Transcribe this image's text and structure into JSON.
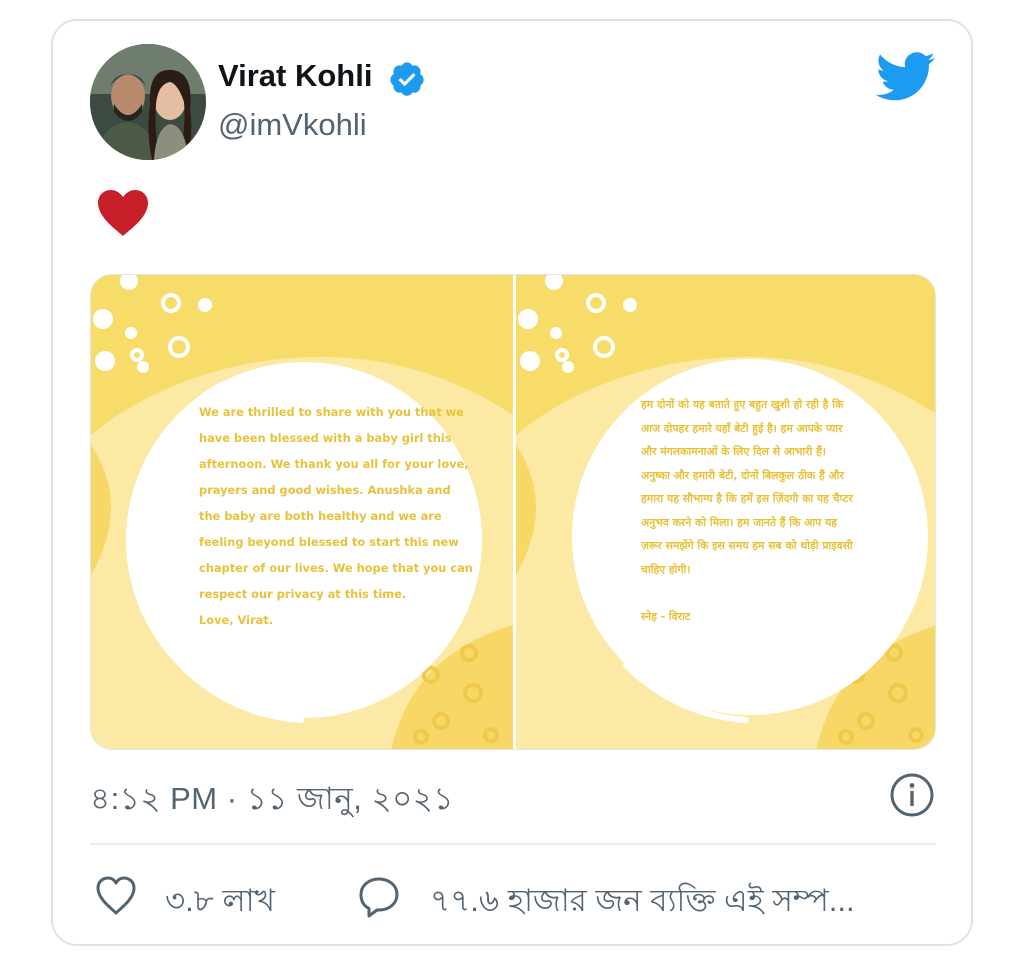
{
  "tweet": {
    "author_name": "Virat Kohli",
    "handle": "@imVkohli",
    "body_emoji": "heart-emoji",
    "timestamp": "৪:১২ PM · ১১ জানু, ২০২১",
    "likes": "৩.৮ লাখ",
    "replies_text": "৭৭.৬ হাজার জন ব্যক্তি এই সম্প..."
  },
  "media": {
    "letter_english": "We are thrilled to share with you that we\nhave been blessed with a baby girl this\nafternoon. We thank you all for your love,\nprayers and good wishes. Anushka and\nthe baby are both healthy and we are\nfeeling beyond blessed to start this new\nchapter of our lives. We hope that you can\nrespect our privacy at this time.\nLove, Virat.",
    "letter_hindi": "हम दोनों को यह बताते हुए बहुत खुशी हो रही है कि\nआज दोपहर हमारे यहाँ बेटी हुई है। हम आपके प्यार\nऔर मंगलकामनाओं के लिए दिल से आभारी हैं।\nअनुष्का और हमारी बेटी, दोनों बिलकुल ठीक हैं और\nहमारा यह सौभाग्य है कि हमें इस ज़िंदगी का यह चैप्टर\nअनुभव करने को मिला। हम जानते हैं कि आप यह\nज़रूर समझेंगे कि इस समय हम सब को थोड़ी प्राइवसी\nचाहिए होगी।\n\nस्नेह - विराट"
  },
  "icons": {
    "brand": "twitter-bird-icon",
    "verified": "verified-badge-icon",
    "info": "info-icon",
    "like": "heart-outline-icon",
    "reply": "speech-bubble-icon"
  },
  "colors": {
    "twitter_blue": "#1d9bf0",
    "heart_red": "#c81e2a",
    "letter_yellow": "#fce59a",
    "text_secondary": "#536471"
  }
}
